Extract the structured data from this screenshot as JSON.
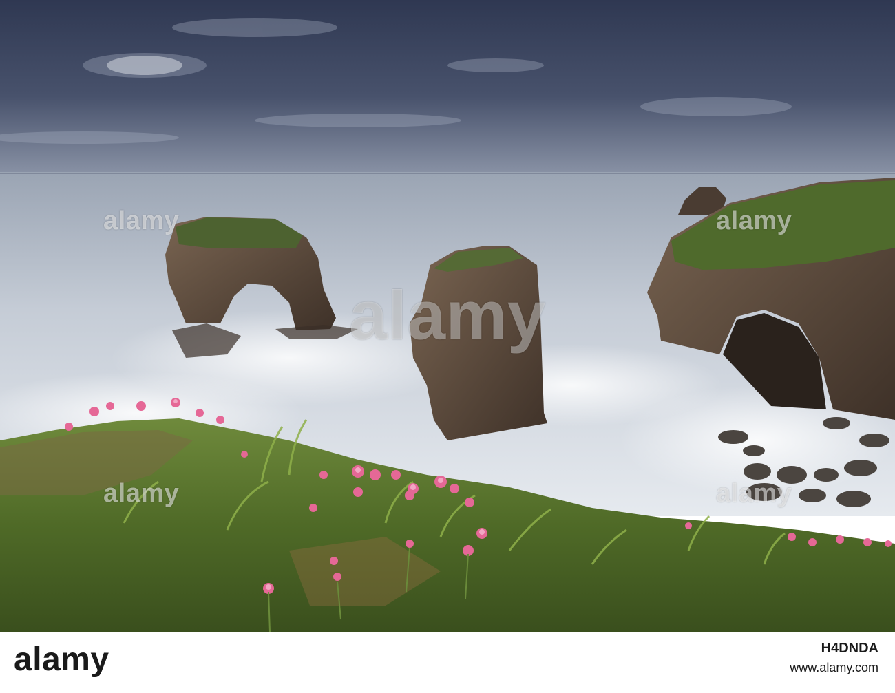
{
  "watermark": {
    "text": "alamy"
  },
  "footer": {
    "logo": "alamy",
    "image_id": "H4DNDA",
    "url": "www.alamy.com"
  },
  "colors": {
    "sky": "#3a4560",
    "sea": "#c8ced8",
    "rock": "#5e4c3d",
    "grass": "#5d7a30",
    "flower": "#e56896"
  }
}
